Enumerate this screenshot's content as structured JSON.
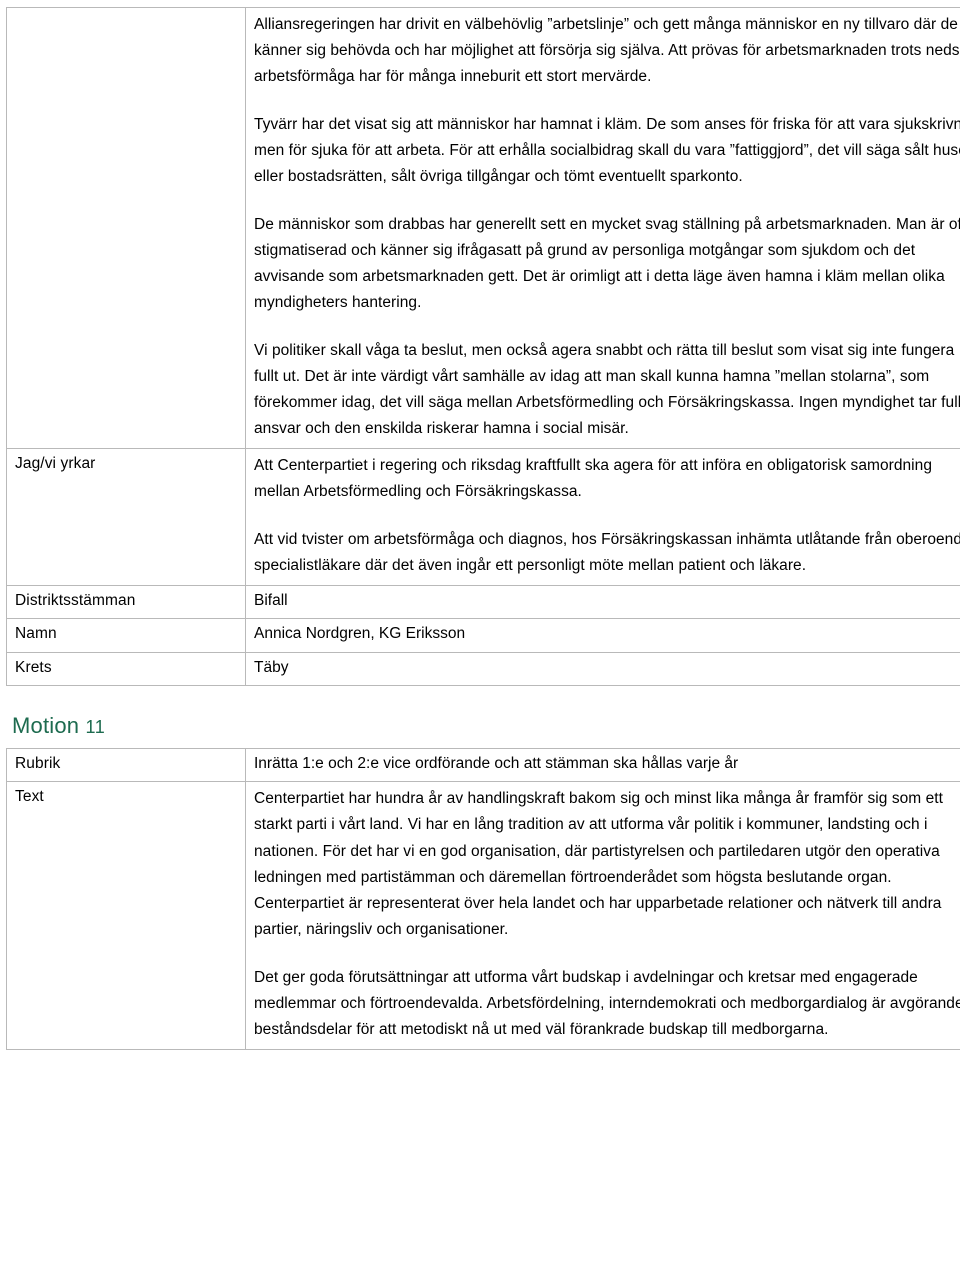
{
  "document": {
    "language": "sv",
    "heading_color": "#1d6b4f"
  },
  "motion_current": {
    "rows": [
      {
        "label": "",
        "paragraphs": [
          "Alliansregeringen har drivit en välbehövlig ”arbetslinje” och gett många människor en ny tillvaro där de känner sig behövda och har möjlighet att försörja sig själva. Att prövas för arbetsmarknaden trots nedsatt arbetsförmåga har för många inneburit ett stort mervärde.",
          "Tyvärr har det visat sig att människor har hamnat i kläm. De som anses för friska för att vara sjukskrivna men för sjuka för att arbeta.  För att erhålla socialbidrag skall du vara ”fattiggjord”, det vill säga sålt huset eller bostadsrätten, sålt övriga tillgångar och tömt eventuellt sparkonto.",
          "De människor som drabbas har generellt sett en mycket svag ställning på arbetsmarknaden. Man är ofta stigmatiserad och känner sig ifrågasatt på grund av personliga motgångar som sjukdom och det avvisande som arbetsmarknaden gett. Det är orimligt att i detta läge även hamna i kläm mellan olika myndigheters hantering.",
          "Vi politiker skall våga ta beslut, men också agera snabbt och rätta till beslut som visat sig inte fungera fullt ut. Det är inte värdigt vårt samhälle av idag att man skall kunna hamna ”mellan stolarna”, som förekommer idag, det vill säga mellan Arbetsförmedling och Försäkringskassa. Ingen myndighet tar fullt ansvar och den enskilda riskerar hamna i social misär."
        ]
      },
      {
        "label": "Jag/vi yrkar",
        "paragraphs": [
          "Att Centerpartiet i regering och riksdag kraftfullt ska agera för att införa en obligatorisk samordning mellan Arbetsförmedling och Försäkringskassa.",
          "Att vid tvister om arbetsförmåga och diagnos, hos Försäkringskassan inhämta utlåtande från oberoende specialistläkare där det även ingår ett personligt möte mellan patient och läkare."
        ]
      },
      {
        "label": "Distriktsstämman",
        "value": "Bifall"
      },
      {
        "label": "Namn",
        "value": "Annica Nordgren, KG Eriksson"
      },
      {
        "label": "Krets",
        "value": "Täby"
      }
    ]
  },
  "motion_next": {
    "heading_word": "Motion",
    "heading_number": "11",
    "rows": [
      {
        "label": "Rubrik",
        "value": "Inrätta 1:e och 2:e vice ordförande och att stämman ska hållas varje år"
      },
      {
        "label": "Text",
        "paragraphs": [
          "Centerpartiet har hundra år av handlingskraft bakom sig och minst lika många år framför sig som ett starkt parti i vårt land. Vi har en lång tradition av att utforma vår politik i kommuner, landsting och i nationen. För det har vi en god organisation, där partistyrelsen och partiledaren utgör den operativa ledningen med partistämman och däremellan förtroenderådet som högsta beslutande organ. Centerpartiet är representerat över hela landet och har upparbetade relationer och nätverk till andra partier, näringsliv och organisationer.",
          "Det ger goda förutsättningar att utforma vårt budskap i avdelningar och kretsar med engagerade medlemmar och förtroendevalda. Arbetsfördelning, interndemokrati och medborgardialog är avgörande beståndsdelar för att metodiskt nå ut med väl förankrade budskap till medborgarna."
        ]
      }
    ]
  }
}
